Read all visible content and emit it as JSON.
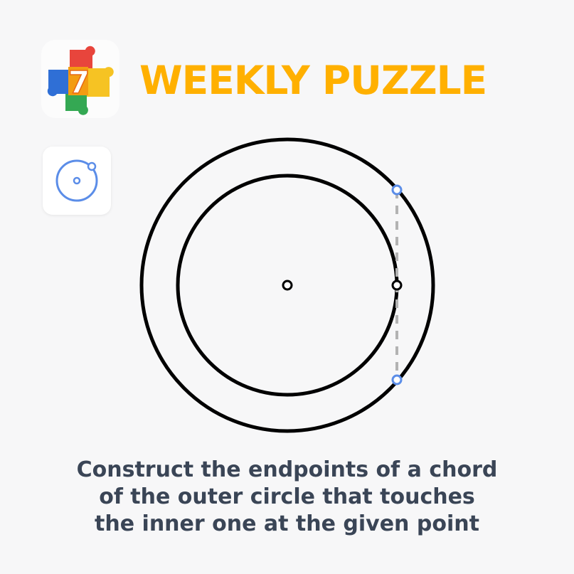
{
  "header": {
    "logo_badge": "7",
    "title": "WEEKLY PUZZLE"
  },
  "toolbar": {
    "tool_icon": "circle-with-point-icon"
  },
  "diagram": {
    "outer_circle_color": "#000000",
    "inner_circle_color": "#000000",
    "chord_color": "#b3b3b3",
    "endpoint_color": "#5b8de8"
  },
  "caption": {
    "lines": [
      "Construct the endpoints of a chord",
      "of the outer circle that touches",
      "the inner one at the given point"
    ]
  },
  "colors": {
    "title": "#ffb000",
    "caption": "#3a4556",
    "background": "#f7f7f8"
  }
}
